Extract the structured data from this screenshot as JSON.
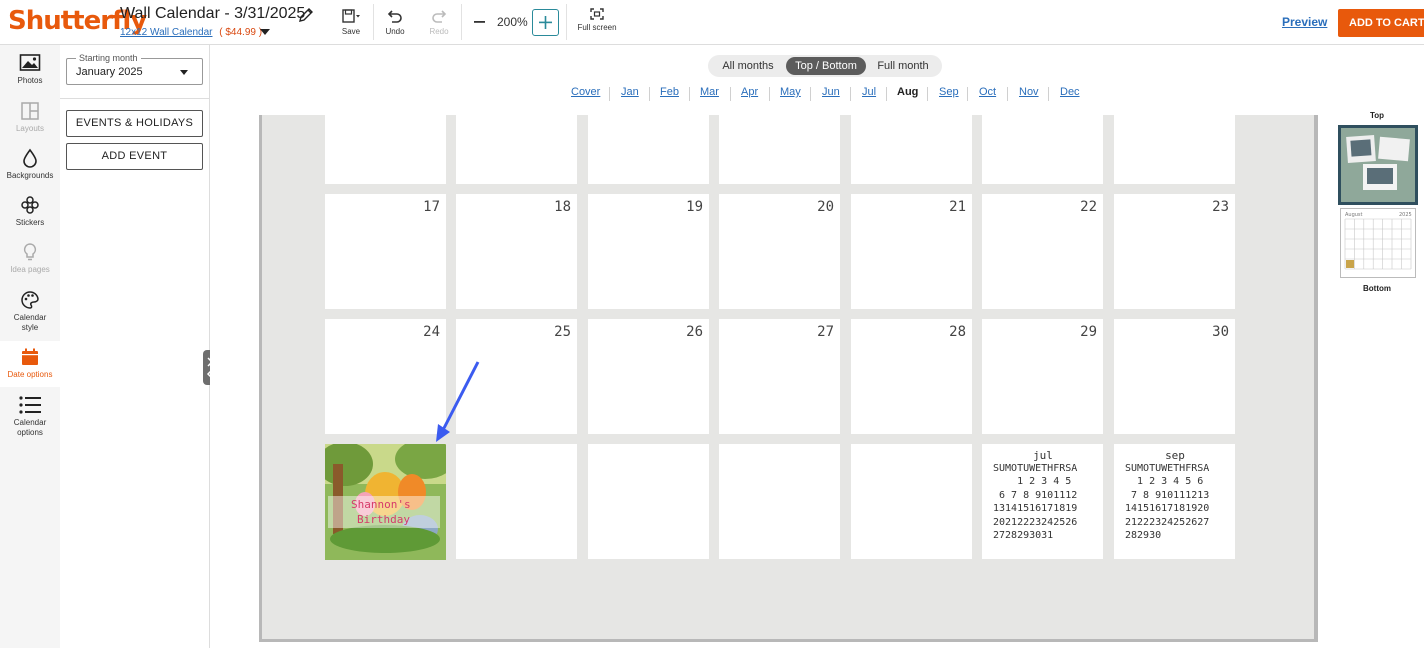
{
  "header": {
    "logo": "Shutterfly",
    "title": "Wall Calendar - 3/31/2025",
    "product_link": "12x12 Wall Calendar",
    "price": "( $44.99 )",
    "tools": {
      "save": "Save",
      "undo": "Undo",
      "redo": "Redo",
      "zoom": "200%",
      "fullscreen": "Full screen"
    },
    "preview": "Preview",
    "add_to_cart": "ADD TO CART"
  },
  "rail": {
    "items": [
      {
        "label": "Photos",
        "icon": "photo-icon"
      },
      {
        "label": "Layouts",
        "icon": "layouts-icon"
      },
      {
        "label": "Backgrounds",
        "icon": "drop-icon"
      },
      {
        "label": "Stickers",
        "icon": "stickers-icon"
      },
      {
        "label": "Idea pages",
        "icon": "lightbulb-icon"
      },
      {
        "label": "Calendar style",
        "icon": "palette-icon"
      },
      {
        "label": "Date options",
        "icon": "calendar-icon"
      },
      {
        "label": "Calendar options",
        "icon": "list-icon"
      }
    ]
  },
  "panel": {
    "starting_month_label": "Starting month",
    "starting_month_value": "January 2025",
    "events_button": "EVENTS & HOLIDAYS",
    "add_event_button": "ADD EVENT"
  },
  "view_toggle": {
    "options": [
      "All months",
      "Top / Bottom",
      "Full month"
    ],
    "selected": "Top / Bottom"
  },
  "month_nav": {
    "items": [
      "Cover",
      "Jan",
      "Feb",
      "Mar",
      "Apr",
      "May",
      "Jun",
      "Jul",
      "Aug",
      "Sep",
      "Oct",
      "Nov",
      "Dec"
    ],
    "selected": "Aug"
  },
  "calendar": {
    "row2": [
      "17",
      "18",
      "19",
      "20",
      "21",
      "22",
      "23"
    ],
    "row3": [
      "24",
      "25",
      "26",
      "27",
      "28",
      "29",
      "30"
    ],
    "photo_caption": [
      "Shannon's",
      "Birthday"
    ],
    "prev_month": {
      "title": "jul",
      "header": "SUMOTUWETHFRSA",
      "rows": [
        "    1 2 3 4 5",
        " 6 7 8 9101112",
        "13141516171819",
        "20212223242526",
        "2728293031"
      ]
    },
    "next_month": {
      "title": "sep",
      "header": "SUMOTUWETHFRSA",
      "rows": [
        "  1 2 3 4 5 6",
        " 7 8 910111213",
        "14151617181920",
        "21222324252627",
        "282930"
      ]
    }
  },
  "thumbnails": {
    "top_label": "Top",
    "bottom_label": "Bottom",
    "bottom_month": "August",
    "bottom_year": "2025"
  },
  "colors": {
    "brand": "#e8590c",
    "link": "#2a6ebb",
    "arrow": "#3b5bf0"
  }
}
